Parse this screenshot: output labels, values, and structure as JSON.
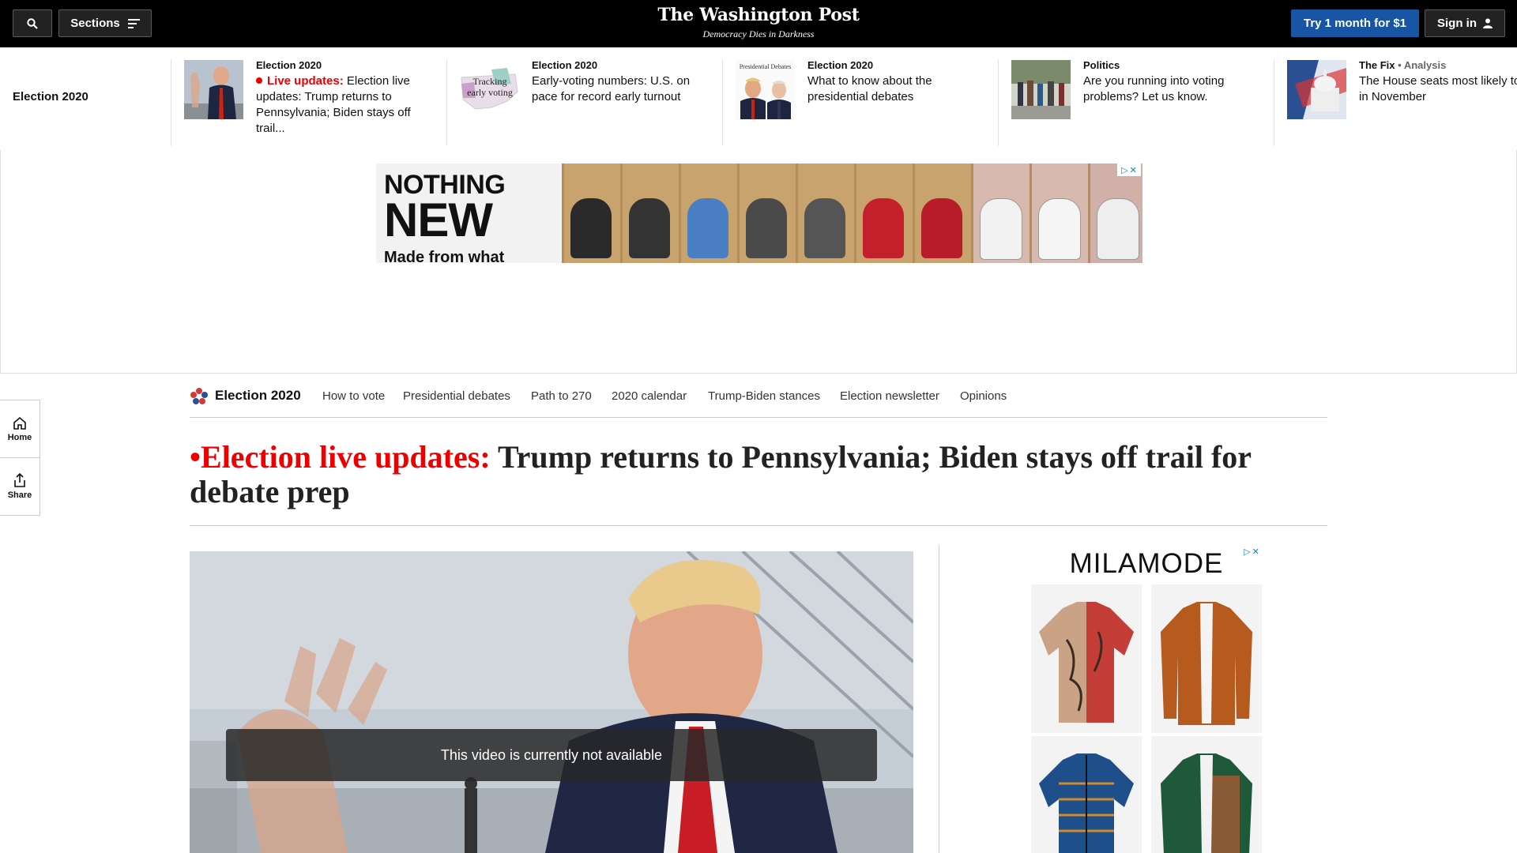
{
  "header": {
    "logo": "The Washington Post",
    "tagline": "Democracy Dies in Darkness",
    "sections_label": "Sections",
    "subscribe_label": "Try 1 month for $1",
    "signin_label": "Sign in"
  },
  "ticker": {
    "label": "Election 2020",
    "items": [
      {
        "kicker": "Election 2020",
        "live_label": "Live updates:",
        "headline": "Election live updates: Trump returns to Pennsylvania; Biden stays off trail..."
      },
      {
        "kicker": "Election 2020",
        "headline": "Early-voting numbers: U.S. on pace for record early turnout"
      },
      {
        "kicker": "Election 2020",
        "headline": "What to know about the presidential debates"
      },
      {
        "kicker": "Politics",
        "headline": "Are you running into voting problems? Let us know."
      },
      {
        "kicker": "The Fix",
        "kicker_extra": "• Analysis",
        "headline": "The House seats most likely to flip in November"
      }
    ],
    "thumb_texts": {
      "tracking": "Tracking early voting",
      "debates": "Presidential Debates"
    }
  },
  "ad_banner": {
    "line1": "NOTHING",
    "line2": "NEW",
    "line3": "Made from what"
  },
  "section_nav": {
    "title": "Election 2020",
    "links": [
      "How to vote",
      "Presidential debates",
      "Path to 270",
      "2020 calendar",
      "Trump-Biden stances",
      "Election newsletter",
      "Opinions"
    ]
  },
  "rail": {
    "home": "Home",
    "share": "Share"
  },
  "article": {
    "live_label": "Election live updates:",
    "title": "Trump returns to Pennsylvania; Biden stays off trail for debate prep",
    "video_message": "This video is currently not available"
  },
  "right_ad": {
    "brand": "MILAMODE"
  },
  "colors": {
    "accent_red": "#e00000",
    "brand_blue": "#1955a5",
    "topbar": "#000000"
  }
}
